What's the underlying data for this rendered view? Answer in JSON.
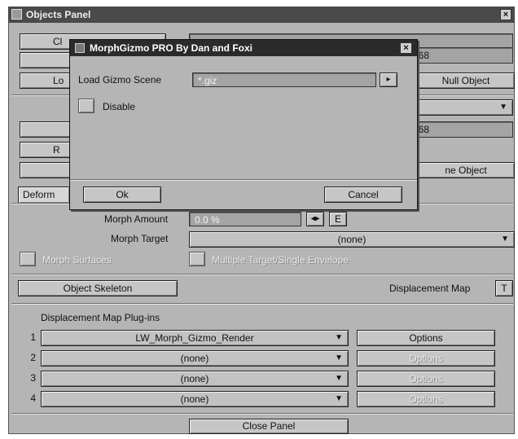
{
  "panel": {
    "title": "Objects Panel",
    "close_glyph": "×",
    "row1": {
      "btn_prefix": "Cl",
      "field_value": ""
    },
    "row2": {
      "field_value": "268"
    },
    "row3": {
      "btn_prefix": "Lo",
      "right_btn": "Null Object"
    },
    "row5": {
      "field_value": "268"
    },
    "row6": {
      "btn_prefix": "R"
    },
    "row7": {
      "right_btn": "ne Object"
    },
    "tab_label": "Deform",
    "morph_amount_label": "Morph Amount",
    "morph_amount_value": "0.0 %",
    "morph_amount_env_btn": "E",
    "morph_target_label": "Morph Target",
    "morph_target_value": "(none)",
    "morph_surfaces_label": "Morph Surfaces",
    "multiple_target_label": "Multiple Target/Single Envelope",
    "object_skeleton_btn": "Object Skeleton",
    "displacement_map_label": "Displacement Map",
    "displacement_map_btn": "T",
    "plugins_heading": "Displacement Map Plug-ins",
    "plugins": [
      {
        "num": "1",
        "name": "LW_Morph_Gizmo_Render",
        "options": "Options",
        "enabled": true
      },
      {
        "num": "2",
        "name": "(none)",
        "options": "Options",
        "enabled": false
      },
      {
        "num": "3",
        "name": "(none)",
        "options": "Options",
        "enabled": false
      },
      {
        "num": "4",
        "name": "(none)",
        "options": "Options",
        "enabled": false
      }
    ],
    "close_panel_btn": "Close Panel"
  },
  "dialog": {
    "title": "MorphGizmo PRO By Dan and Foxi",
    "close_glyph": "×",
    "load_label": "Load Gizmo Scene",
    "load_value": "*.giz",
    "browse_glyph": "▸",
    "disable_label": "Disable",
    "ok_btn": "Ok",
    "cancel_btn": "Cancel"
  },
  "icons": {
    "window": "app-window-icon",
    "dropdown": "chevron-down-icon",
    "close": "close-icon"
  },
  "colors": {
    "panel_bg": "#b5b5b5",
    "titlebar": "#4a4a4a",
    "dialog_titlebar": "#2b2b2b"
  }
}
